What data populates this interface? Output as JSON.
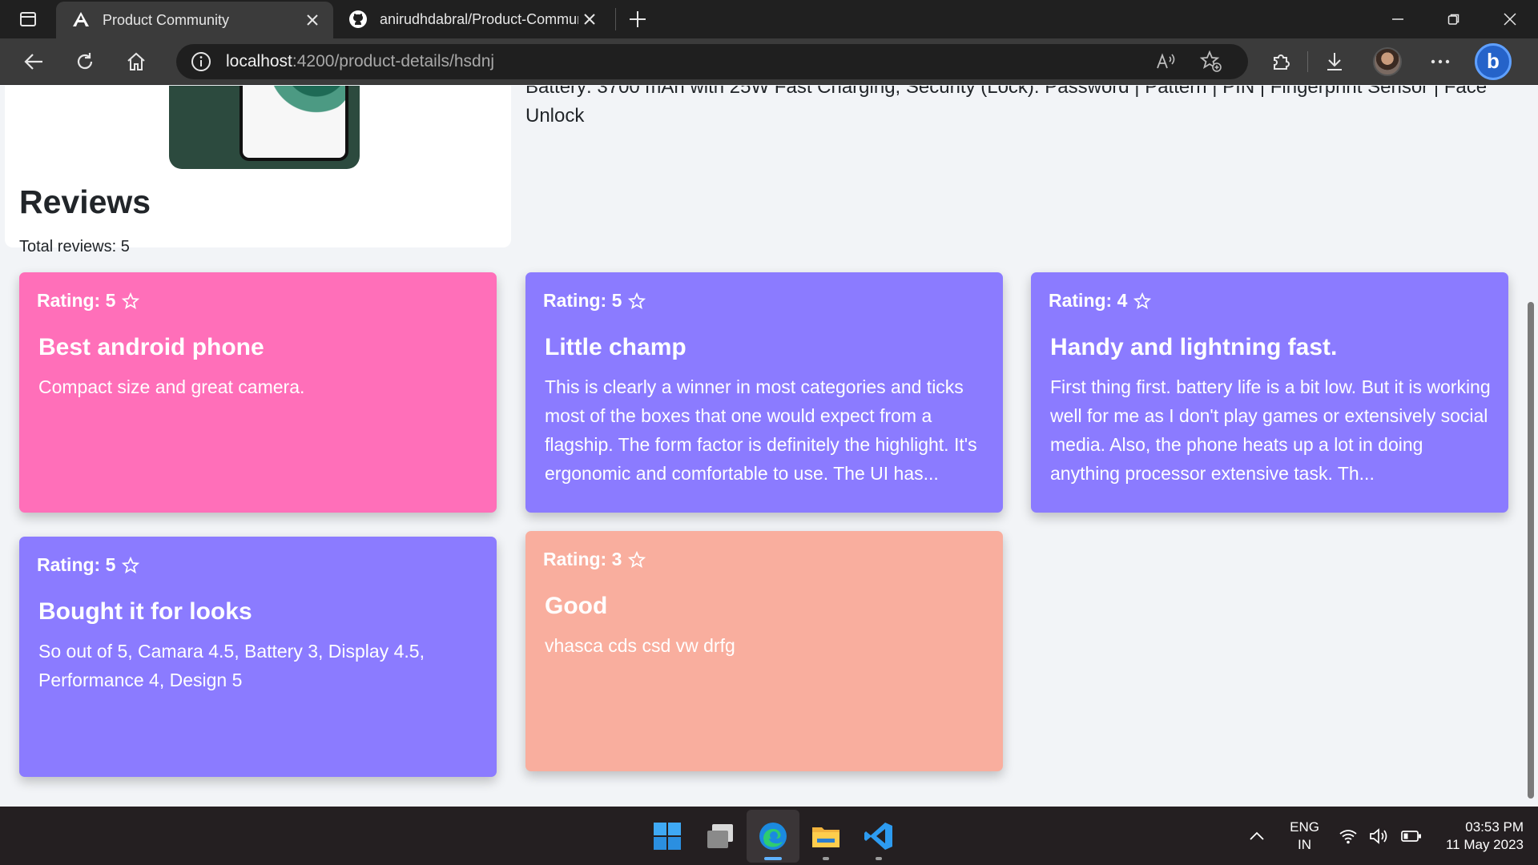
{
  "browser": {
    "tabs": [
      {
        "title": "Product Community",
        "active": true,
        "icon": "angular-icon"
      },
      {
        "title": "anirudhdabral/Product-Commur",
        "active": false,
        "icon": "github-icon"
      }
    ],
    "url_host": "localhost",
    "url_path": ":4200/product-details/hsdnj"
  },
  "product": {
    "specs_text": "Battery: 3700 mAh with 25W Fast Charging, Security (Lock): Password | Pattern | PIN | Fingerprint Sensor | Face Unlock"
  },
  "reviews": {
    "heading": "Reviews",
    "total_label": "Total reviews: 5",
    "items": [
      {
        "rating_label": "Rating: 5",
        "title": "Best android phone",
        "body": "Compact size and great camera.",
        "color": "#ff6fb9"
      },
      {
        "rating_label": "Rating: 5",
        "title": "Little champ",
        "body": "This is clearly a winner in most categories and ticks most of the boxes that one would expect from a flagship. The form factor is definitely the highlight. It's ergonomic and comfortable to use. The UI has...",
        "color": "#8b7bff"
      },
      {
        "rating_label": "Rating: 4",
        "title": "Handy and lightning fast.",
        "body": "First thing first. battery life is a bit low. But it is working well for me as I don't play games or extensively social media. Also, the phone heats up a lot in doing anything processor extensive task. Th...",
        "color": "#8b7bff"
      },
      {
        "rating_label": "Rating: 5",
        "title": "Bought it for looks",
        "body": "So out of 5, Camara 4.5, Battery 3, Display 4.5, Performance 4, Design 5",
        "color": "#8b7bff"
      },
      {
        "rating_label": "Rating: 3",
        "title": "Good",
        "body": "vhasca cds csd vw drfg",
        "color": "#f9ae9e"
      }
    ]
  },
  "taskbar": {
    "lang_line1": "ENG",
    "lang_line2": "IN",
    "time": "03:53 PM",
    "date": "11 May 2023"
  },
  "colors": {
    "pink_card": "#ff6fb9",
    "purple_card": "#8b7bff",
    "salmon_card": "#f9ae9e"
  }
}
